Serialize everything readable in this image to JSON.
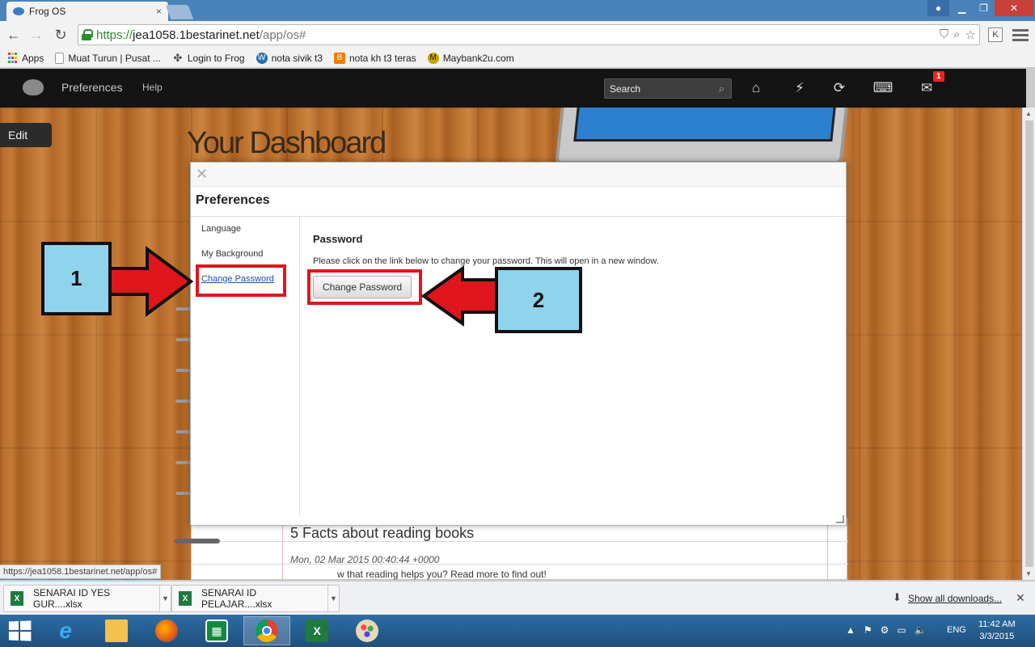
{
  "browser": {
    "tab_title": "Frog OS",
    "tab_close": "×",
    "window_controls": {
      "minimize": "▁",
      "maximize": "❐",
      "close": "✕"
    },
    "url": {
      "scheme": "https://",
      "host": "jea1058.1bestarinet.net",
      "path": "/app/os#"
    },
    "extension_label": "K",
    "bookmarks": [
      {
        "label": "Apps",
        "icon": "apps-grid-icon"
      },
      {
        "label": "Muat Turun | Pusat ...",
        "icon": "page-icon"
      },
      {
        "label": "Login to Frog",
        "icon": "frog-icon"
      },
      {
        "label": "nota sivik t3",
        "icon": "wordpress-icon"
      },
      {
        "label": "nota kh t3 teras",
        "icon": "blogger-icon"
      },
      {
        "label": "Maybank2u.com",
        "icon": "maybank-icon"
      }
    ]
  },
  "frog": {
    "nav": {
      "preferences": "Preferences",
      "help": "Help"
    },
    "search_placeholder": "Search",
    "notification_count": "1",
    "icons": [
      "home-icon",
      "lightning-icon",
      "refresh-cycle-icon",
      "keyboard-icon",
      "chat-icon"
    ]
  },
  "dashboard": {
    "edit_label": "Edit",
    "title": "Your Dashboard",
    "post_title": "5 Facts about reading books",
    "post_date": "Mon, 02 Mar 2015 00:40:44 +0000",
    "post_excerpt": "w that reading helps you? Read more to find out!"
  },
  "dialog": {
    "close_glyph": "✕",
    "title": "Preferences",
    "menu": [
      "Language",
      "My Background",
      "Change Password"
    ],
    "section_heading": "Password",
    "section_text": "Please click on the link below to change your password. This will open in a new window.",
    "button_label": "Change Password"
  },
  "annotations": {
    "step1": "1",
    "step2": "2",
    "highlight_color": "#e0161c",
    "callout_color": "#8fd3ec"
  },
  "status_url": "https://jea1058.1bestarinet.net/app/os#",
  "downloads": {
    "items": [
      "SENARAI ID YES GUR....xlsx",
      "SENARAI ID PELAJAR....xlsx"
    ],
    "show_all": "Show all downloads...",
    "close_glyph": "✕"
  },
  "taskbar": {
    "apps": [
      "internet-explorer-icon",
      "file-explorer-icon",
      "firefox-icon",
      "store-icon",
      "chrome-icon",
      "excel-icon",
      "paint-icon"
    ],
    "language": "ENG",
    "time": "11:42 AM",
    "date": "3/3/2015"
  }
}
